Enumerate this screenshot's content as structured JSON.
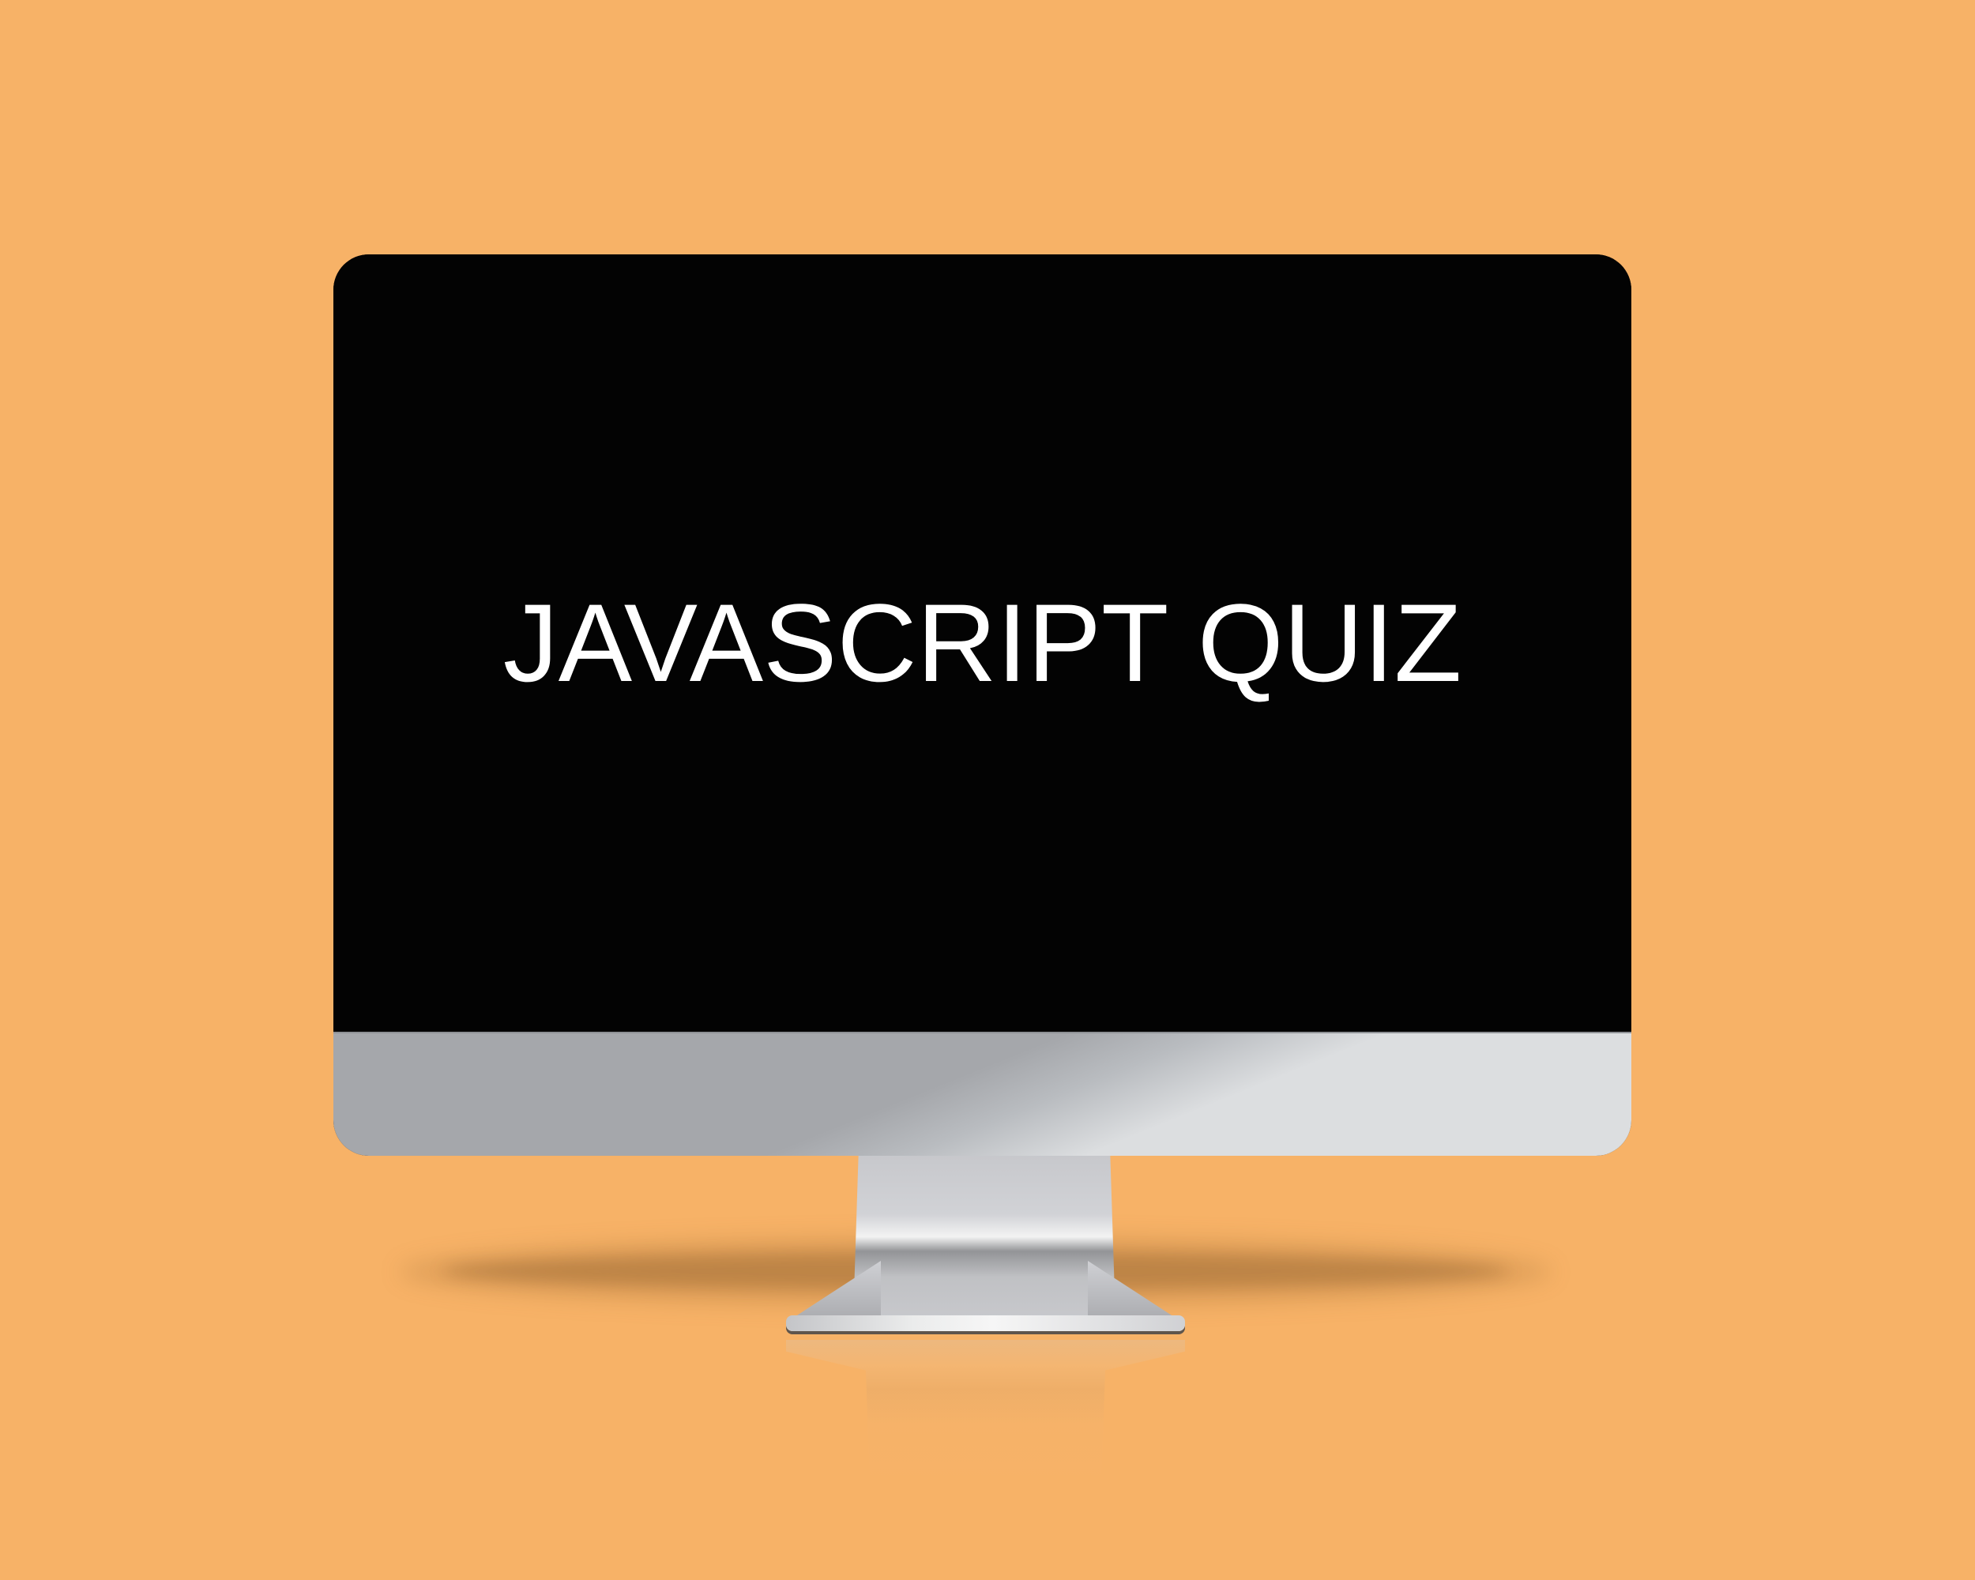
{
  "scene": {
    "title": "JAVASCRIPT QUIZ"
  },
  "colors": {
    "background": "#f7b267",
    "screen": "#030303",
    "text": "#ffffff",
    "silver_light": "#dcdee0",
    "silver_dark": "#a5a7ab"
  }
}
